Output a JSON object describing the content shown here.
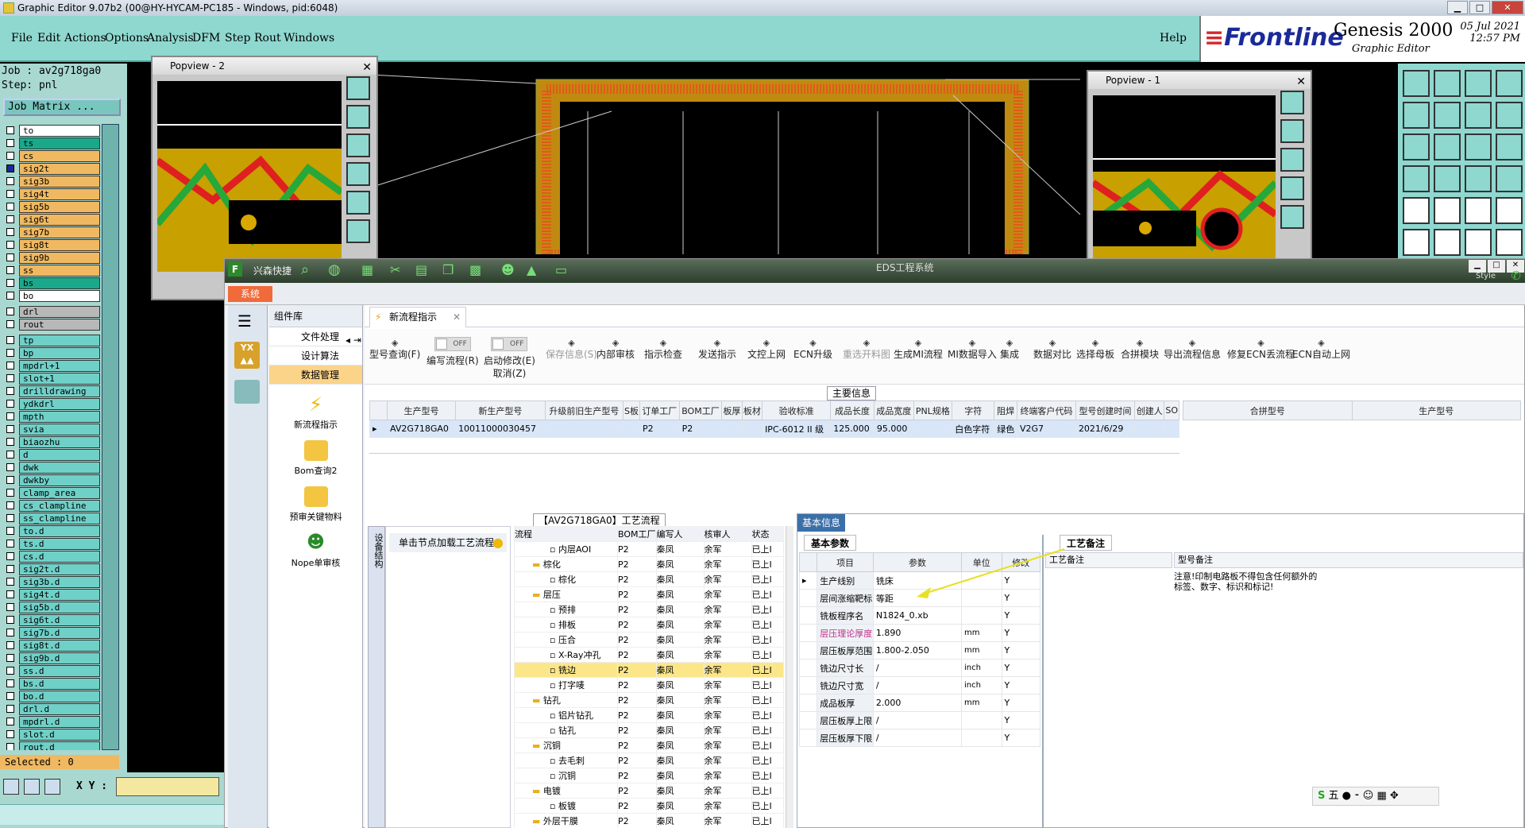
{
  "window": {
    "title": "Graphic Editor 9.07b2 (00@HY-HYCAM-PC185 - Windows, pid:6048)"
  },
  "menu": [
    "File",
    "Edit",
    "Actions",
    "Options",
    "Analysis",
    "DFM",
    "Step",
    "Rout",
    "Windows"
  ],
  "help": "Help",
  "brand": {
    "logo": "Frontline",
    "product": "Genesis 2000",
    "sub": "Graphic Editor",
    "date": "05 Jul 2021",
    "time": "12:57 PM"
  },
  "job": {
    "job_line": "Job : av2g718ga0",
    "step_line": "Step: pnl",
    "matrix_btn": "Job Matrix ..."
  },
  "layers": [
    {
      "name": "to",
      "color": "#ffffff"
    },
    {
      "name": "ts",
      "color": "#19a88a"
    },
    {
      "name": "cs",
      "color": "#f0b860"
    },
    {
      "name": "sig2t",
      "color": "#f0b860",
      "mark": "red"
    },
    {
      "name": "sig3b",
      "color": "#f0b860"
    },
    {
      "name": "sig4t",
      "color": "#f0b860"
    },
    {
      "name": "sig5b",
      "color": "#f0b860"
    },
    {
      "name": "sig6t",
      "color": "#f0b860"
    },
    {
      "name": "sig7b",
      "color": "#f0b860"
    },
    {
      "name": "sig8t",
      "color": "#f0b860"
    },
    {
      "name": "sig9b",
      "color": "#f0b860"
    },
    {
      "name": "ss",
      "color": "#f0b860"
    },
    {
      "name": "bs",
      "color": "#19a88a"
    },
    {
      "name": "bo",
      "color": "#ffffff"
    },
    {
      "name": "drl",
      "color": "#b8b8b8"
    },
    {
      "name": "rout",
      "color": "#b8b8b8"
    },
    {
      "name": "tp",
      "color": "#6fd0c8"
    },
    {
      "name": "bp",
      "color": "#6fd0c8"
    },
    {
      "name": "mpdrl+1",
      "color": "#6fd0c8"
    },
    {
      "name": "slot+1",
      "color": "#6fd0c8"
    },
    {
      "name": "drilldrawing",
      "color": "#6fd0c8"
    },
    {
      "name": "ydkdrl",
      "color": "#6fd0c8"
    },
    {
      "name": "mpth",
      "color": "#6fd0c8"
    },
    {
      "name": "svia",
      "color": "#6fd0c8"
    },
    {
      "name": "biaozhu",
      "color": "#6fd0c8"
    },
    {
      "name": "d",
      "color": "#6fd0c8"
    },
    {
      "name": "dwk",
      "color": "#6fd0c8"
    },
    {
      "name": "dwkby",
      "color": "#6fd0c8"
    },
    {
      "name": "clamp_area",
      "color": "#6fd0c8"
    },
    {
      "name": "cs_clampline",
      "color": "#6fd0c8"
    },
    {
      "name": "ss_clampline",
      "color": "#6fd0c8"
    },
    {
      "name": "to.d",
      "color": "#6fd0c8"
    },
    {
      "name": "ts.d",
      "color": "#6fd0c8"
    },
    {
      "name": "cs.d",
      "color": "#6fd0c8"
    },
    {
      "name": "sig2t.d",
      "color": "#6fd0c8"
    },
    {
      "name": "sig3b.d",
      "color": "#6fd0c8"
    },
    {
      "name": "sig4t.d",
      "color": "#6fd0c8"
    },
    {
      "name": "sig5b.d",
      "color": "#6fd0c8"
    },
    {
      "name": "sig6t.d",
      "color": "#6fd0c8"
    },
    {
      "name": "sig7b.d",
      "color": "#6fd0c8"
    },
    {
      "name": "sig8t.d",
      "color": "#6fd0c8"
    },
    {
      "name": "sig9b.d",
      "color": "#6fd0c8"
    },
    {
      "name": "ss.d",
      "color": "#6fd0c8"
    },
    {
      "name": "bs.d",
      "color": "#6fd0c8"
    },
    {
      "name": "bo.d",
      "color": "#6fd0c8"
    },
    {
      "name": "drl.d",
      "color": "#6fd0c8"
    },
    {
      "name": "mpdrl.d",
      "color": "#6fd0c8"
    },
    {
      "name": "slot.d",
      "color": "#6fd0c8"
    },
    {
      "name": "rout.d",
      "color": "#6fd0c8"
    }
  ],
  "selected": "Selected : 0",
  "xy_label": "X Y :",
  "popview2": "Popview - 2",
  "popview1": "Popview - 1",
  "eds": {
    "app_name": "兴森快捷",
    "title": "EDS工程系统",
    "style_label": "Style",
    "sys_tab": "系统",
    "sidebar_head": "组件库",
    "sidebar_items": [
      "文件处理",
      "设计算法",
      "数据管理"
    ],
    "sidebar_icons": [
      "新流程指示",
      "Bom查询2",
      "预审关键物料",
      "Nope单审核"
    ],
    "tab": "新流程指示",
    "toolbar": [
      {
        "label": "型号查询(F)",
        "dis": false
      },
      {
        "label": "编写流程(R)",
        "dis": false
      },
      {
        "label": "启动修改(E)",
        "sub": "取消(Z)",
        "dis": false
      },
      {
        "label": "保存信息(S)",
        "dis": true
      },
      {
        "label": "内部审核",
        "dis": false
      },
      {
        "label": "指示检查",
        "dis": false
      },
      {
        "label": "发送指示",
        "dis": false
      },
      {
        "label": "文控上网",
        "dis": false
      },
      {
        "label": "ECN升级",
        "dis": false
      },
      {
        "label": "重选开料图",
        "dis": true
      },
      {
        "label": "生成MI流程",
        "dis": false
      },
      {
        "label": "MI数据导入",
        "dis": false
      },
      {
        "label": "集成",
        "dis": false
      },
      {
        "label": "数据对比",
        "dis": false
      },
      {
        "label": "选择母板",
        "dis": false
      },
      {
        "label": "合拼模块",
        "dis": false
      },
      {
        "label": "导出流程信息",
        "dis": false
      },
      {
        "label": "修复ECN丢流程",
        "dis": false
      },
      {
        "label": "ECN自动上网",
        "dis": false
      }
    ],
    "toggle_off": "OFF",
    "main_info": "主要信息",
    "main_cols": [
      "生产型号",
      "新生产型号",
      "升级前旧生产型号",
      "S板",
      "订单工厂",
      "BOM工厂",
      "板厚",
      "板材",
      "验收标准",
      "成品长度",
      "成品宽度",
      "PNL规格",
      "字符",
      "阻焊",
      "终端客户代码",
      "型号创建时间",
      "创建人",
      "SO"
    ],
    "main_row": [
      "AV2G718GA0",
      "10011000030457",
      "",
      "",
      "P2",
      "P2",
      "",
      "",
      "IPC-6012 II 级",
      "125.000",
      "95.000",
      "",
      "白色字符",
      "绿色",
      "V2G7",
      "2021/6/29",
      "",
      ""
    ],
    "merge_cols": [
      "合拼型号",
      "生产型号"
    ],
    "process_title": "【AV2G718GA0】工艺流程",
    "device_struct": "设备结构",
    "node_hint": "单击节点加载工艺流程",
    "proc_cols": [
      "流程",
      "BOM工厂",
      "编写人",
      "核审人",
      "状态"
    ],
    "proc_rows": [
      {
        "name": "内层AOI",
        "lvl": 2,
        "f": "P2",
        "w": "秦凤",
        "r": "余军",
        "s": "已上I"
      },
      {
        "name": "棕化",
        "lvl": 1,
        "f": "P2",
        "w": "秦凤",
        "r": "余军",
        "s": "已上I"
      },
      {
        "name": "棕化",
        "lvl": 2,
        "f": "P2",
        "w": "秦凤",
        "r": "余军",
        "s": "已上I"
      },
      {
        "name": "层压",
        "lvl": 1,
        "f": "P2",
        "w": "秦凤",
        "r": "余军",
        "s": "已上I"
      },
      {
        "name": "预排",
        "lvl": 2,
        "f": "P2",
        "w": "秦凤",
        "r": "余军",
        "s": "已上I"
      },
      {
        "name": "排板",
        "lvl": 2,
        "f": "P2",
        "w": "秦凤",
        "r": "余军",
        "s": "已上I"
      },
      {
        "name": "压合",
        "lvl": 2,
        "f": "P2",
        "w": "秦凤",
        "r": "余军",
        "s": "已上I"
      },
      {
        "name": "X-Ray冲孔",
        "lvl": 2,
        "f": "P2",
        "w": "秦凤",
        "r": "余军",
        "s": "已上I"
      },
      {
        "name": "铣边",
        "lvl": 2,
        "f": "P2",
        "w": "秦凤",
        "r": "余军",
        "s": "已上I",
        "hl": true
      },
      {
        "name": "打字唛",
        "lvl": 2,
        "f": "P2",
        "w": "秦凤",
        "r": "余军",
        "s": "已上I"
      },
      {
        "name": "钻孔",
        "lvl": 1,
        "f": "P2",
        "w": "秦凤",
        "r": "余军",
        "s": "已上I"
      },
      {
        "name": "铝片钻孔",
        "lvl": 2,
        "f": "P2",
        "w": "秦凤",
        "r": "余军",
        "s": "已上I"
      },
      {
        "name": "钻孔",
        "lvl": 2,
        "f": "P2",
        "w": "秦凤",
        "r": "余军",
        "s": "已上I"
      },
      {
        "name": "沉铜",
        "lvl": 1,
        "f": "P2",
        "w": "秦凤",
        "r": "余军",
        "s": "已上I"
      },
      {
        "name": "去毛刺",
        "lvl": 2,
        "f": "P2",
        "w": "秦凤",
        "r": "余军",
        "s": "已上I"
      },
      {
        "name": "沉铜",
        "lvl": 2,
        "f": "P2",
        "w": "秦凤",
        "r": "余军",
        "s": "已上I"
      },
      {
        "name": "电镀",
        "lvl": 1,
        "f": "P2",
        "w": "秦凤",
        "r": "余军",
        "s": "已上I"
      },
      {
        "name": "板镀",
        "lvl": 2,
        "f": "P2",
        "w": "秦凤",
        "r": "余军",
        "s": "已上I"
      },
      {
        "name": "外层干膜",
        "lvl": 1,
        "f": "P2",
        "w": "秦凤",
        "r": "余军",
        "s": "已上I"
      }
    ],
    "basic_info": "基本信息",
    "basic_params": "基本参数",
    "param_cols": [
      "项目",
      "参数",
      "单位",
      "修改"
    ],
    "params": [
      {
        "k": "生产线别",
        "v": "铣床",
        "u": "",
        "m": "Y"
      },
      {
        "k": "层间涨缩靶标",
        "v": "等距",
        "u": "",
        "m": "Y"
      },
      {
        "k": "铣板程序名",
        "v": "N1824_0.xb",
        "u": "",
        "m": "Y"
      },
      {
        "k": "层压理论厚度",
        "v": "1.890",
        "u": "mm",
        "m": "Y",
        "pink": true
      },
      {
        "k": "层压板厚范围",
        "v": "1.800-2.050",
        "u": "mm",
        "m": "Y"
      },
      {
        "k": "铣边尺寸长",
        "v": "/",
        "u": "inch",
        "m": "Y"
      },
      {
        "k": "铣边尺寸宽",
        "v": "/",
        "u": "inch",
        "m": "Y"
      },
      {
        "k": "成品板厚",
        "v": "2.000",
        "u": "mm",
        "m": "Y"
      },
      {
        "k": "层压板厚上限",
        "v": "/",
        "u": "",
        "m": "Y"
      },
      {
        "k": "层压板厚下限",
        "v": "/",
        "u": "",
        "m": "Y"
      }
    ],
    "craft_note_tab": "工艺备注",
    "craft_note_col": "工艺备注",
    "model_note_col": "型号备注",
    "model_note": "注意!印制电路板不得包含任何额外的标签、数字、标识和标记!",
    "ime": "五",
    "tray": "CH"
  }
}
